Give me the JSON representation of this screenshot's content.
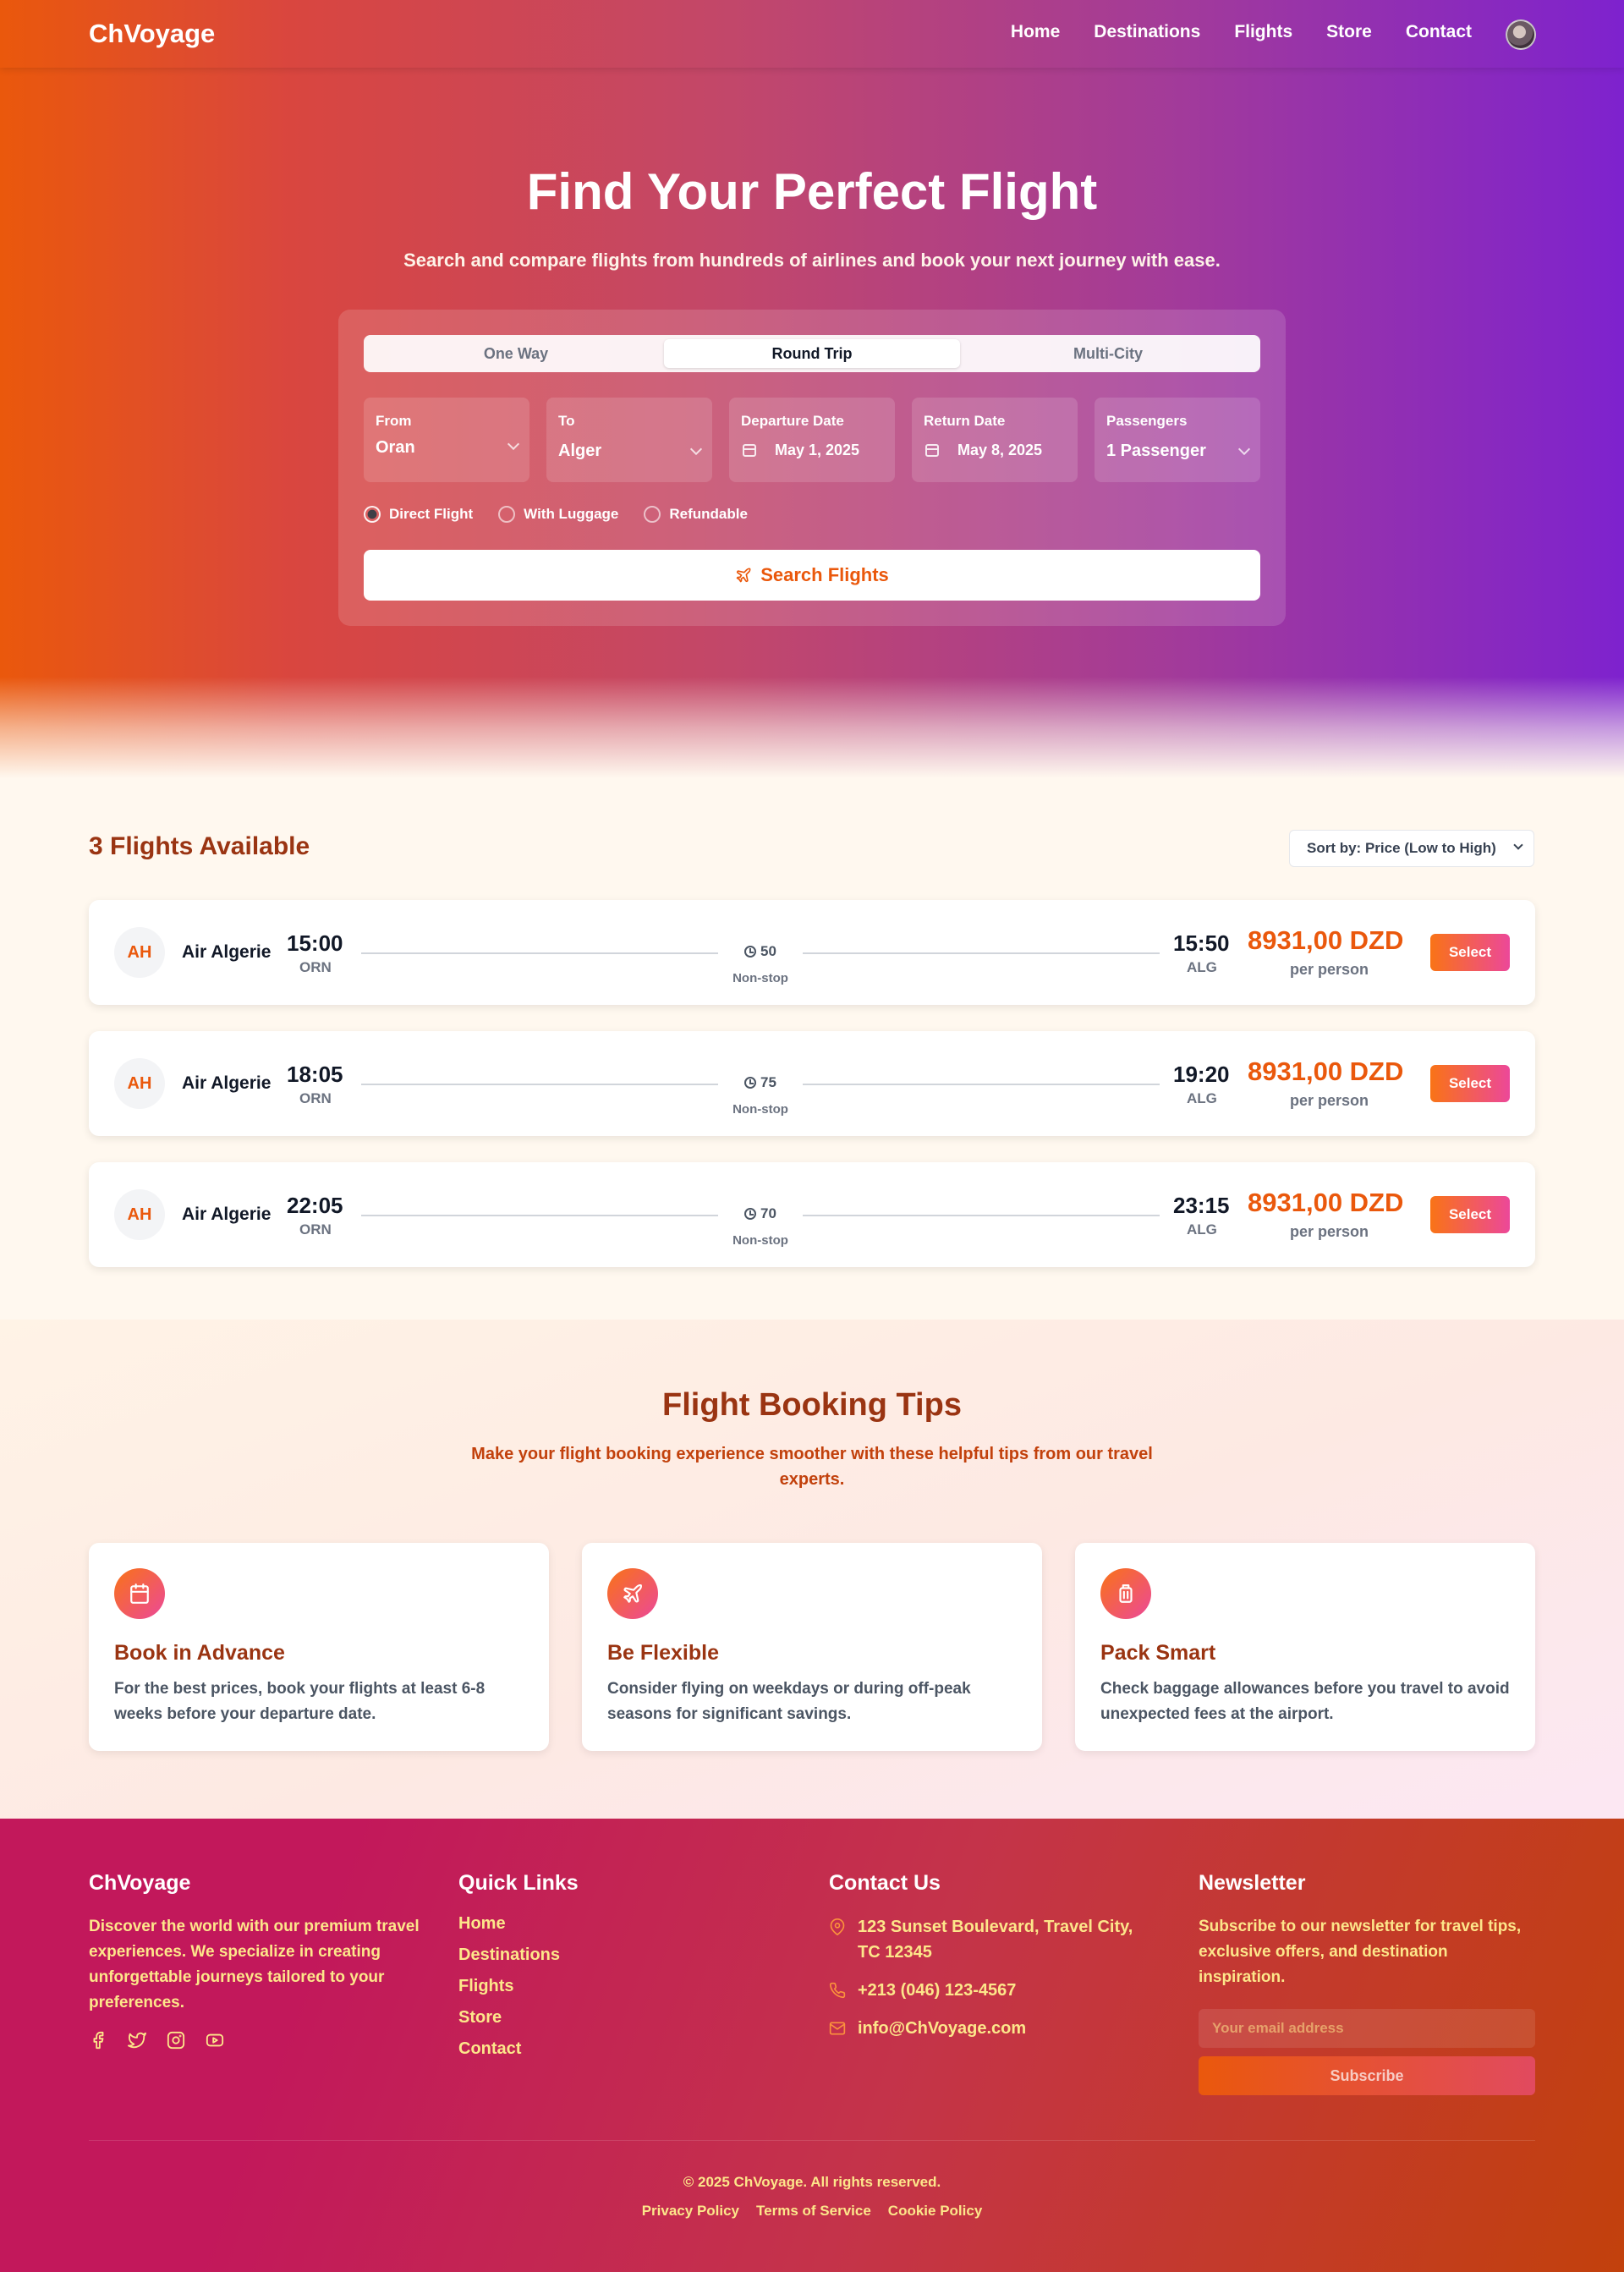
{
  "brand": "ChVoyage",
  "nav": {
    "items": [
      "Home",
      "Destinations",
      "Flights",
      "Store",
      "Contact"
    ]
  },
  "hero": {
    "title": "Find Your Perfect Flight",
    "subtitle": "Search and compare flights from hundreds of airlines and book your next journey with ease."
  },
  "search": {
    "tabs": [
      "One Way",
      "Round Trip",
      "Multi-City"
    ],
    "active_tab": "Round Trip",
    "fields": {
      "from": {
        "label": "From",
        "value": "Oran"
      },
      "to": {
        "label": "To",
        "value": "Alger"
      },
      "departure": {
        "label": "Departure Date",
        "value": "May 1, 2025"
      },
      "return": {
        "label": "Return Date",
        "value": "May 8, 2025"
      },
      "passengers": {
        "label": "Passengers",
        "value": "1 Passenger"
      }
    },
    "options": [
      {
        "label": "Direct Flight",
        "checked": true
      },
      {
        "label": "With Luggage",
        "checked": false
      },
      {
        "label": "Refundable",
        "checked": false
      }
    ],
    "button_label": "Search Flights",
    "button_icon": "plane-icon"
  },
  "results": {
    "title": "3 Flights Available",
    "sort_label": "Sort by: Price (Low to High)",
    "flights": [
      {
        "logo": "AH",
        "airline": "Air Algerie",
        "dep_time": "15:00",
        "dep_code": "ORN",
        "duration": "50",
        "stops": "Non-stop",
        "arr_time": "15:50",
        "arr_code": "ALG",
        "price": "8931,00 DZD",
        "per": "per person",
        "button": "Select"
      },
      {
        "logo": "AH",
        "airline": "Air Algerie",
        "dep_time": "18:05",
        "dep_code": "ORN",
        "duration": "75",
        "stops": "Non-stop",
        "arr_time": "19:20",
        "arr_code": "ALG",
        "price": "8931,00 DZD",
        "per": "per person",
        "button": "Select"
      },
      {
        "logo": "AH",
        "airline": "Air Algerie",
        "dep_time": "22:05",
        "dep_code": "ORN",
        "duration": "70",
        "stops": "Non-stop",
        "arr_time": "23:15",
        "arr_code": "ALG",
        "price": "8931,00 DZD",
        "per": "per person",
        "button": "Select"
      }
    ]
  },
  "tips": {
    "title": "Flight Booking Tips",
    "subtitle": "Make your flight booking experience smoother with these helpful tips from our travel experts.",
    "cards": [
      {
        "icon": "calendar-icon",
        "title": "Book in Advance",
        "text": "For the best prices, book your flights at least 6-8 weeks before your departure date."
      },
      {
        "icon": "plane-icon",
        "title": "Be Flexible",
        "text": "Consider flying on weekdays or during off-peak seasons for significant savings."
      },
      {
        "icon": "luggage-icon",
        "title": "Pack Smart",
        "text": "Check baggage allowances before you travel to avoid unexpected fees at the airport."
      }
    ]
  },
  "footer": {
    "about": {
      "title": "ChVoyage",
      "text": "Discover the world with our premium travel experiences. We specialize in creating unforgettable journeys tailored to your preferences.",
      "socials": [
        "facebook-icon",
        "twitter-icon",
        "instagram-icon",
        "youtube-icon"
      ]
    },
    "links": {
      "title": "Quick Links",
      "items": [
        "Home",
        "Destinations",
        "Flights",
        "Store",
        "Contact"
      ]
    },
    "contact": {
      "title": "Contact Us",
      "address": "123 Sunset Boulevard, Travel City, TC 12345",
      "phone": "+213 (046) 123-4567",
      "email": "info@ChVoyage.com"
    },
    "newsletter": {
      "title": "Newsletter",
      "text": "Subscribe to our newsletter for travel tips, exclusive offers, and destination inspiration.",
      "placeholder": "Your email address",
      "button": "Subscribe"
    },
    "copyright": "© 2025 ChVoyage. All rights reserved.",
    "legal": [
      "Privacy Policy",
      "Terms of Service",
      "Cookie Policy"
    ]
  },
  "colors": {
    "accent": "#ea580c",
    "heading": "#9a3412",
    "gradient_start": "#ea580c",
    "gradient_end": "#7e22ce"
  }
}
